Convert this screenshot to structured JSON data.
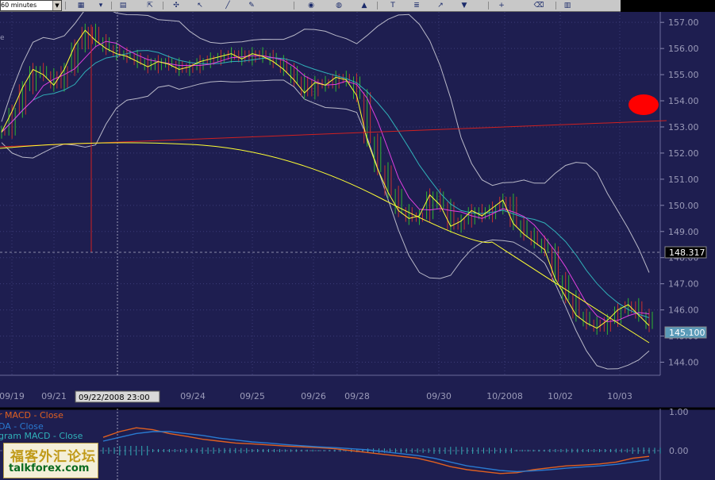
{
  "toolbar": {
    "timeframe": "60 minutes",
    "icons": [
      "chart-type-icon",
      "bar-style-icon",
      "properties-icon",
      "cursor-icon",
      "crosshair-icon",
      "pointer-icon",
      "line-tool-icon",
      "pencil-icon",
      "eye-icon",
      "globe-icon",
      "chart-icon",
      "text-tool-icon",
      "indicator-icon",
      "trend-line-icon",
      "marker-icon",
      "plus-icon",
      "eraser-icon",
      "data-window-icon"
    ]
  },
  "price_labels": {
    "current": "148.317",
    "last": "145.100"
  },
  "date_tag": "09/22/2008 23:00",
  "macd_panel": {
    "legend": [
      "r MACD - Close",
      "DA - Close",
      "gram MACD - Close"
    ],
    "ticks": [
      "1.00",
      "0.00"
    ]
  },
  "watermark": {
    "cn": "福客外汇论坛",
    "url": "talkforex.com"
  },
  "colors": {
    "background": "#1e1e50",
    "candle_up": "#2fb52f",
    "candle_down": "#c83030",
    "line_yellow": "#ffff33",
    "line_magenta": "#e040e0",
    "line_cyan": "#30b0b8",
    "bands": "#b8b8c8",
    "trend_red": "#d02020",
    "marker_red": "#ff0000",
    "grid": "#3c3c78"
  },
  "chart_data": {
    "type": "line",
    "y_ticks": [
      "157.00",
      "156.00",
      "155.00",
      "154.00",
      "153.00",
      "152.00",
      "151.00",
      "150.00",
      "149.00",
      "148.00",
      "147.00",
      "146.00",
      "145.00",
      "144.00"
    ],
    "ylim": [
      143.5,
      157.4
    ],
    "x_labels": [
      "09/19",
      "09/21",
      "09/24",
      "09/25",
      "09/26",
      "09/28",
      "09/30",
      "10/2008",
      "10/02",
      "10/03"
    ],
    "grid": true,
    "series": [
      {
        "name": "Close",
        "values": [
          152.8,
          153.6,
          154.5,
          155.2,
          155.0,
          154.6,
          155.2,
          156.1,
          156.7,
          156.3,
          156.0,
          155.8,
          155.7,
          155.5,
          155.3,
          155.5,
          155.4,
          155.2,
          155.3,
          155.5,
          155.6,
          155.7,
          155.8,
          155.6,
          155.8,
          155.7,
          155.5,
          155.2,
          154.8,
          154.3,
          154.7,
          154.6,
          154.9,
          154.8,
          154.2,
          152.5,
          151.4,
          150.5,
          149.8,
          149.5,
          149.6,
          150.4,
          150.0,
          149.2,
          149.4,
          149.8,
          149.6,
          149.9,
          150.2,
          149.3,
          148.9,
          148.6,
          148.3,
          147.2,
          146.5,
          145.8,
          145.5,
          145.3,
          145.6,
          146.0,
          146.2,
          145.8,
          145.4
        ]
      }
    ],
    "macd": {
      "ylim": [
        -1.2,
        1.2
      ],
      "macd": [
        0.35,
        0.5,
        0.6,
        0.55,
        0.45,
        0.38,
        0.3,
        0.25,
        0.2,
        0.18,
        0.15,
        0.12,
        0.1,
        0.08,
        0.05,
        0.0,
        -0.05,
        -0.1,
        -0.15,
        -0.2,
        -0.3,
        -0.42,
        -0.5,
        -0.55,
        -0.6,
        -0.58,
        -0.5,
        -0.45,
        -0.4,
        -0.38,
        -0.35,
        -0.3,
        -0.2,
        -0.15
      ],
      "signal": [
        0.25,
        0.35,
        0.45,
        0.5,
        0.5,
        0.45,
        0.4,
        0.33,
        0.28,
        0.23,
        0.2,
        0.16,
        0.13,
        0.1,
        0.08,
        0.05,
        0.02,
        -0.03,
        -0.08,
        -0.13,
        -0.2,
        -0.3,
        -0.4,
        -0.46,
        -0.52,
        -0.55,
        -0.53,
        -0.5,
        -0.46,
        -0.43,
        -0.4,
        -0.36,
        -0.3,
        -0.24
      ],
      "histogram": [
        0.1,
        0.15,
        0.15,
        0.05,
        -0.05,
        -0.07,
        -0.1,
        -0.08,
        -0.08,
        -0.05,
        -0.05,
        -0.04,
        -0.03,
        -0.02,
        -0.03,
        -0.05,
        -0.07,
        -0.07,
        -0.07,
        -0.07,
        -0.1,
        -0.12,
        -0.1,
        -0.09,
        -0.08,
        -0.03,
        0.03,
        0.05,
        0.06,
        0.05,
        0.05,
        0.06,
        0.1,
        0.09
      ]
    }
  }
}
